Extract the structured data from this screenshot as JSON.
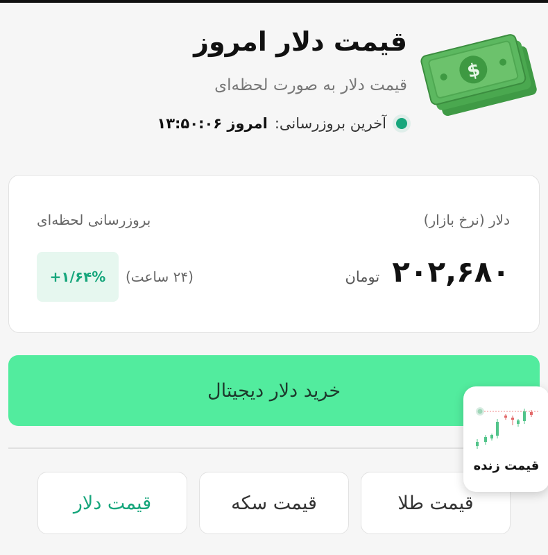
{
  "header": {
    "title": "قیمت دلار امروز",
    "subtitle": "قیمت دلار به صورت لحظه‌ای",
    "update_label": "آخرین بروزرسانی:",
    "update_value": "امروز ۱۳:۵۰:۰۶"
  },
  "price_card": {
    "currency_label": "دلار (نرخ بازار)",
    "live_label": "بروزرسانی لحظه‌ای",
    "price": "۲۰۲,۶۸۰",
    "unit": "تومان",
    "change_period": "(۲۴ ساعت)",
    "change_value": "+۱/۶۴%"
  },
  "buy_button": {
    "label": "خرید دلار دیجیتال"
  },
  "tabs": [
    {
      "label": "قیمت طلا",
      "active": false
    },
    {
      "label": "قیمت سکه",
      "active": false
    },
    {
      "label": "قیمت دلار",
      "active": true
    }
  ],
  "live_widget": {
    "label": "قیمت زنده"
  },
  "colors": {
    "accent": "#17a67c",
    "button_bg": "#52ec9e",
    "badge_bg": "#e6f7ef",
    "money_green": "#6cc26c"
  },
  "icons": {
    "money": "banknote-stack-icon",
    "status": "green-dot-icon",
    "chart": "candlestick-chart-icon"
  }
}
